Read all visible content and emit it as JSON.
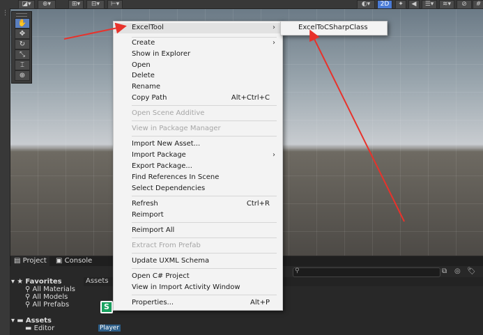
{
  "toolbar": {
    "right_2d": "2D"
  },
  "context_menu": {
    "items": [
      {
        "label": "ExcelTool",
        "submenu": true
      },
      {
        "label": "Create",
        "submenu": true
      },
      {
        "label": "Show in Explorer"
      },
      {
        "label": "Open"
      },
      {
        "label": "Delete"
      },
      {
        "label": "Rename"
      },
      {
        "label": "Copy Path",
        "shortcut": "Alt+Ctrl+C"
      },
      {
        "label": "Open Scene Additive",
        "disabled": true
      },
      {
        "label": "View in Package Manager",
        "disabled": true
      },
      {
        "label": "Import New Asset..."
      },
      {
        "label": "Import Package",
        "submenu": true
      },
      {
        "label": "Export Package..."
      },
      {
        "label": "Find References In Scene"
      },
      {
        "label": "Select Dependencies"
      },
      {
        "label": "Refresh",
        "shortcut": "Ctrl+R"
      },
      {
        "label": "Reimport"
      },
      {
        "label": "Reimport All"
      },
      {
        "label": "Extract From Prefab",
        "disabled": true
      },
      {
        "label": "Update UXML Schema"
      },
      {
        "label": "Open C# Project"
      },
      {
        "label": "View in Import Activity Window"
      },
      {
        "label": "Properties...",
        "shortcut": "Alt+P"
      }
    ],
    "submenu_arrow": "›"
  },
  "submenu": {
    "items": [
      {
        "label": "ExcelToCSharpClass"
      }
    ]
  },
  "bottom_panel": {
    "tabs": [
      "Project",
      "Console"
    ],
    "add_label": "+▾",
    "tree": {
      "favorites": "Favorites",
      "favorite_items": [
        "All Materials",
        "All Models",
        "All Prefabs"
      ],
      "assets": "Assets",
      "asset_items": [
        "Editor"
      ]
    },
    "breadcrumb": "Assets",
    "asset_file": {
      "name": "Player",
      "icon": "spreadsheet-file-icon",
      "color": "#1aa260"
    }
  },
  "colors": {
    "annotation_arrow": "#e8322b",
    "menu_bg": "#f3f3f3",
    "editor_dark": "#282828"
  }
}
